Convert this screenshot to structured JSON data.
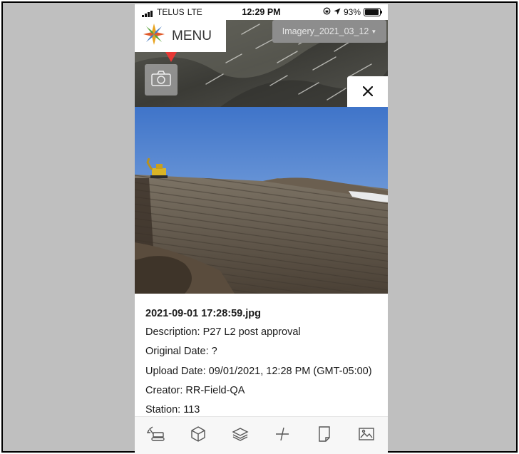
{
  "status_bar": {
    "carrier": "TELUS",
    "network": "LTE",
    "time": "12:29 PM",
    "battery": "93%",
    "battery_level": 0.93
  },
  "map": {
    "menu_label": "MENU",
    "imagery_selected": "Imagery_2021_03_12",
    "marker_color": "#e53935"
  },
  "photo_details": {
    "filename": "2021-09-01 17:28:59.jpg",
    "description": "Description: P27 L2 post approval",
    "original_date": "Original Date: ?",
    "upload_date": "Upload Date: 09/01/2021, 12:28 PM (GMT-05:00)",
    "creator": "Creator: RR-Field-QA",
    "station": "Station: 113"
  },
  "toolbar": {
    "tools": [
      "excavator-icon",
      "cube-icon",
      "layers-icon",
      "measure-icon",
      "document-icon",
      "image-icon"
    ]
  }
}
